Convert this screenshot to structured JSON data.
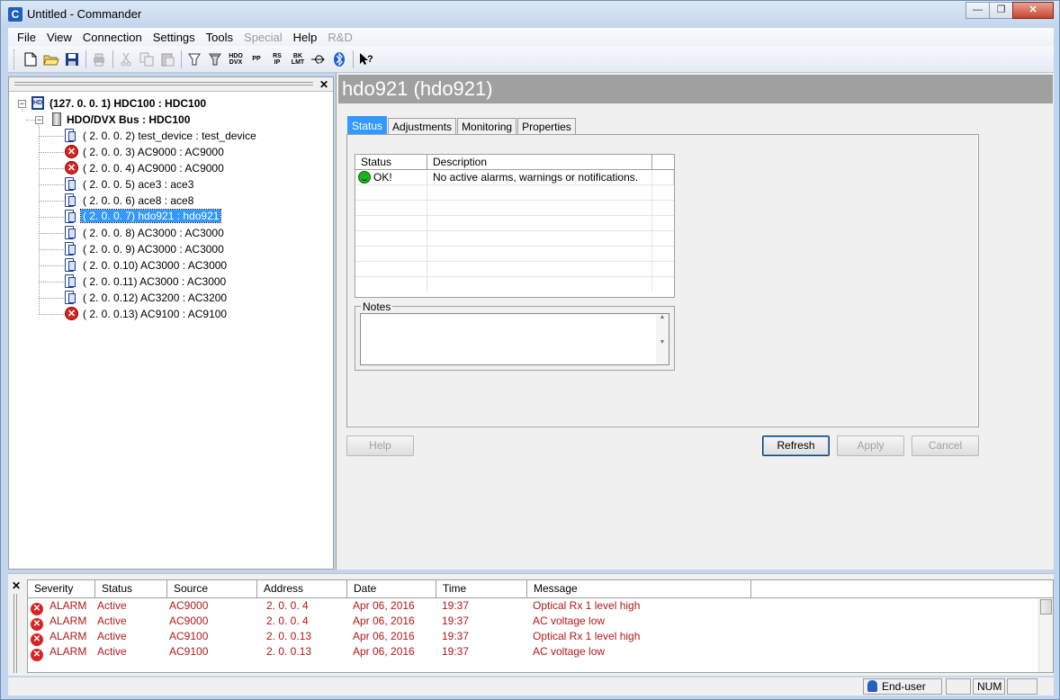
{
  "window": {
    "title": "Untitled - Commander",
    "icon_letter": "C"
  },
  "menu": [
    {
      "label": "File",
      "disabled": false
    },
    {
      "label": "View",
      "disabled": false
    },
    {
      "label": "Connection",
      "disabled": false
    },
    {
      "label": "Settings",
      "disabled": false
    },
    {
      "label": "Tools",
      "disabled": false
    },
    {
      "label": "Special",
      "disabled": true
    },
    {
      "label": "Help",
      "disabled": false
    },
    {
      "label": "R&D",
      "disabled": true
    }
  ],
  "toolbar": {
    "hdo_dvx": [
      "HDO",
      "DVX"
    ],
    "pp": "PP",
    "rs_ip": [
      "RS",
      "IP"
    ],
    "bk_lmt": [
      "BK",
      "LMT"
    ]
  },
  "tree": {
    "root": "(127.  0.  0.  1) HDC100 : HDC100",
    "bus": "HDO/DVX Bus : HDC100",
    "devices": [
      {
        "label": "(  2.  0.  0.  2) test_device : test_device",
        "state": "ok"
      },
      {
        "label": "(  2.  0.  0.  3) AC9000 : AC9000",
        "state": "error"
      },
      {
        "label": "(  2.  0.  0.  4) AC9000 : AC9000",
        "state": "error"
      },
      {
        "label": "(  2.  0.  0.  5) ace3 : ace3",
        "state": "ok"
      },
      {
        "label": "(  2.  0.  0.  6) ace8 : ace8",
        "state": "ok"
      },
      {
        "label": "(  2.  0.  0.  7) hdo921 : hdo921",
        "state": "ok",
        "selected": true
      },
      {
        "label": "(  2.  0.  0.  8) AC3000 : AC3000",
        "state": "ok"
      },
      {
        "label": "(  2.  0.  0.  9) AC3000 : AC3000",
        "state": "ok"
      },
      {
        "label": "(  2.  0.  0.10) AC3000 : AC3000",
        "state": "ok"
      },
      {
        "label": "(  2.  0.  0.11) AC3000 : AC3000",
        "state": "ok"
      },
      {
        "label": "(  2.  0.  0.12) AC3200 : AC3200",
        "state": "ok"
      },
      {
        "label": "(  2.  0.  0.13) AC9100 : AC9100",
        "state": "error"
      }
    ]
  },
  "device_header": "hdo921 (hdo921)",
  "tabs": [
    "Status",
    "Adjustments",
    "Monitoring",
    "Properties"
  ],
  "status_table": {
    "columns": [
      "Status",
      "Description"
    ],
    "rows": [
      {
        "status": "OK!",
        "description": "No active alarms, warnings or notifications."
      }
    ]
  },
  "notes_label": "Notes",
  "buttons": {
    "help": "Help",
    "refresh": "Refresh",
    "apply": "Apply",
    "cancel": "Cancel"
  },
  "alarms": {
    "columns": [
      "Severity",
      "Status",
      "Source",
      "Address",
      "Date",
      "Time",
      "Message"
    ],
    "rows": [
      {
        "severity": "ALARM",
        "status": "Active",
        "source": "AC9000",
        "address": "2.  0.  0.  4",
        "date": "Apr 06, 2016",
        "time": "19:37",
        "message": "Optical Rx 1 level high"
      },
      {
        "severity": "ALARM",
        "status": "Active",
        "source": "AC9000",
        "address": "2.  0.  0.  4",
        "date": "Apr 06, 2016",
        "time": "19:37",
        "message": "AC voltage low"
      },
      {
        "severity": "ALARM",
        "status": "Active",
        "source": "AC9100",
        "address": "2.  0.  0.13",
        "date": "Apr 06, 2016",
        "time": "19:37",
        "message": "Optical Rx 1 level high"
      },
      {
        "severity": "ALARM",
        "status": "Active",
        "source": "AC9100",
        "address": "2.  0.  0.13",
        "date": "Apr 06, 2016",
        "time": "19:37",
        "message": "AC voltage low"
      }
    ]
  },
  "statusbar": {
    "user": "End-user",
    "num": "NUM"
  }
}
